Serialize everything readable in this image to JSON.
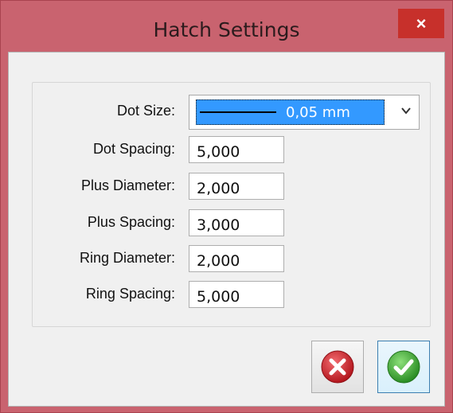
{
  "window": {
    "title": "Hatch Settings",
    "close_label": "×"
  },
  "form": {
    "dot_size": {
      "label": "Dot Size:",
      "value": "0,05 mm"
    },
    "dot_spacing": {
      "label": "Dot Spacing:",
      "value": "5,000"
    },
    "plus_diameter": {
      "label": "Plus Diameter:",
      "value": "2,000"
    },
    "plus_spacing": {
      "label": "Plus Spacing:",
      "value": "3,000"
    },
    "ring_diameter": {
      "label": "Ring Diameter:",
      "value": "2,000"
    },
    "ring_spacing": {
      "label": "Ring Spacing:",
      "value": "5,000"
    }
  },
  "buttons": {
    "cancel_icon": "cancel-icon",
    "ok_icon": "checkmark-icon"
  },
  "colors": {
    "title_bar": "#c9636f",
    "close_button": "#c7302b",
    "selection": "#3399ff",
    "cancel": "#d9333a",
    "ok": "#3fae3a"
  }
}
